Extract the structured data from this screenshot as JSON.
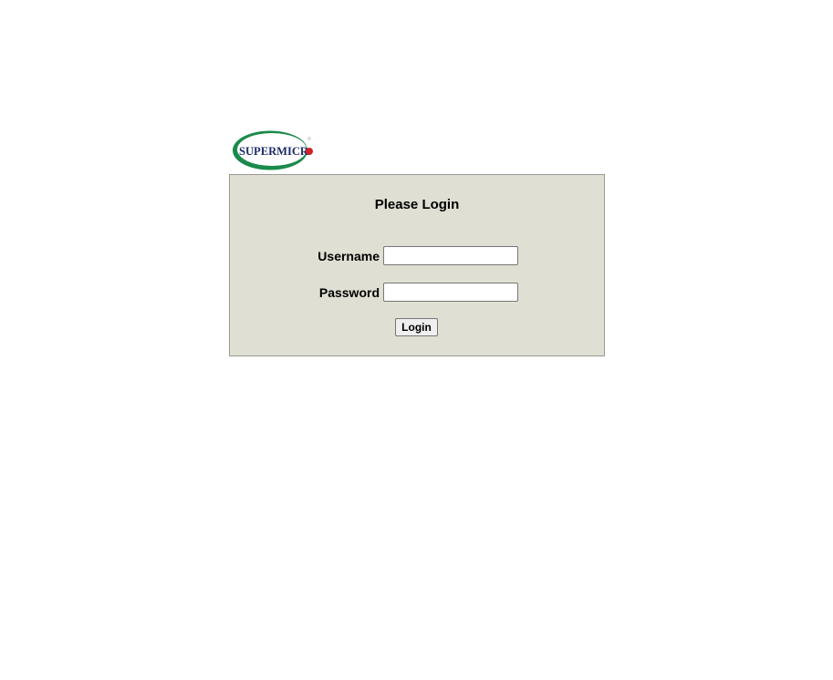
{
  "logo": {
    "text": "SUPERMICR",
    "accent_color": "#1a8a4a",
    "text_color": "#1d2a6b",
    "dot_color": "#d42027"
  },
  "login": {
    "title": "Please Login",
    "username_label": "Username",
    "password_label": "Password",
    "username_value": "",
    "password_value": "",
    "button_label": "Login"
  }
}
